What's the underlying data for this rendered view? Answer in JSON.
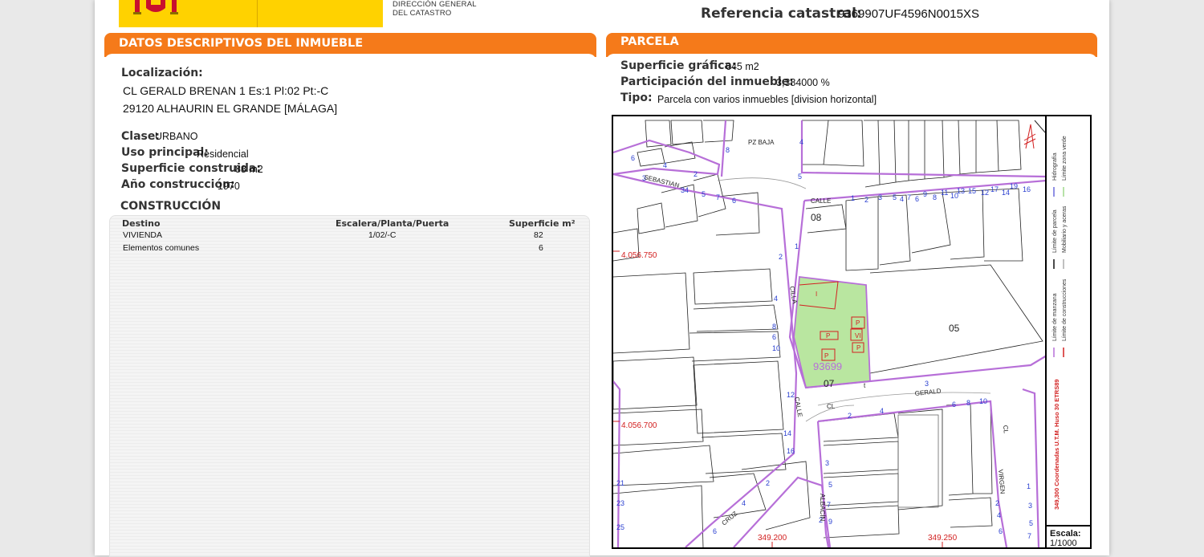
{
  "header": {
    "agency_line1": "DIRECCIÓN GENERAL",
    "agency_line2": "DEL CATASTRO",
    "ref_label": "Referencia catastral:",
    "ref_value": "9369907UF4596N0015XS"
  },
  "inmueble": {
    "title": "DATOS DESCRIPTIVOS DEL INMUEBLE",
    "localizacion_label": "Localización:",
    "address_line1": "CL GERALD BRENAN 1 Es:1 Pl:02 Pt:-C",
    "address_line2": "29120 ALHAURIN EL GRANDE [MÁLAGA]",
    "clase_label": "Clase:",
    "clase_value": "URBANO",
    "uso_label": "Uso principal:",
    "uso_value": "Residencial",
    "superficie_label": "Superficie construida:",
    "superficie_value": "88 m2",
    "anio_label": "Año construcción:",
    "anio_value": "1970"
  },
  "construccion": {
    "title": "CONSTRUCCIÓN",
    "columns": [
      "Destino",
      "Escalera/Planta/Puerta",
      "Superficie m²"
    ],
    "rows": [
      {
        "destino": "VIVIENDA",
        "epp": "1/02/-C",
        "superficie": "82"
      },
      {
        "destino": "Elementos comunes",
        "epp": "",
        "superficie": "6"
      }
    ]
  },
  "parcela": {
    "title": "PARCELA",
    "superficie_label": "Superficie gráfica:",
    "superficie_value": "645 m2",
    "participacion_label": "Participación del inmueble:",
    "participacion_value": "3,384000 %",
    "tipo_label": "Tipo:",
    "tipo_value": "Parcela con varios inmuebles [division horizontal]"
  },
  "map": {
    "parcel_label": "93699",
    "plot_labels": [
      "08",
      "05",
      "07",
      "PZ BAJA",
      "SEBASTIAN",
      "CALLE",
      "CL",
      "GERALD",
      "CALLE",
      "CILLA",
      "CRUZ",
      "ALBACÍN",
      "VIRGEN",
      "CL"
    ],
    "coord_y1": "4.056.750",
    "coord_y2": "4.056.700",
    "coord_x1": "349.200",
    "coord_x2": "349.250",
    "legend": [
      "Hidrografía",
      "Límite zona verde",
      "Límite de parcela",
      "Mobiliario y aceras",
      "Límite de manzana",
      "Límite de construcciones"
    ],
    "crs_note": "349,300 Coordenadas U.T.M. Huso 30 ETRS89",
    "escala_label": "Escala:",
    "escala_value": "1/1000",
    "colors": {
      "parcel_fill": "#b9e6a0",
      "limit_purple": "#b76fd8",
      "coord_red": "#d22020",
      "number_blue": "#2a3fd0"
    }
  }
}
